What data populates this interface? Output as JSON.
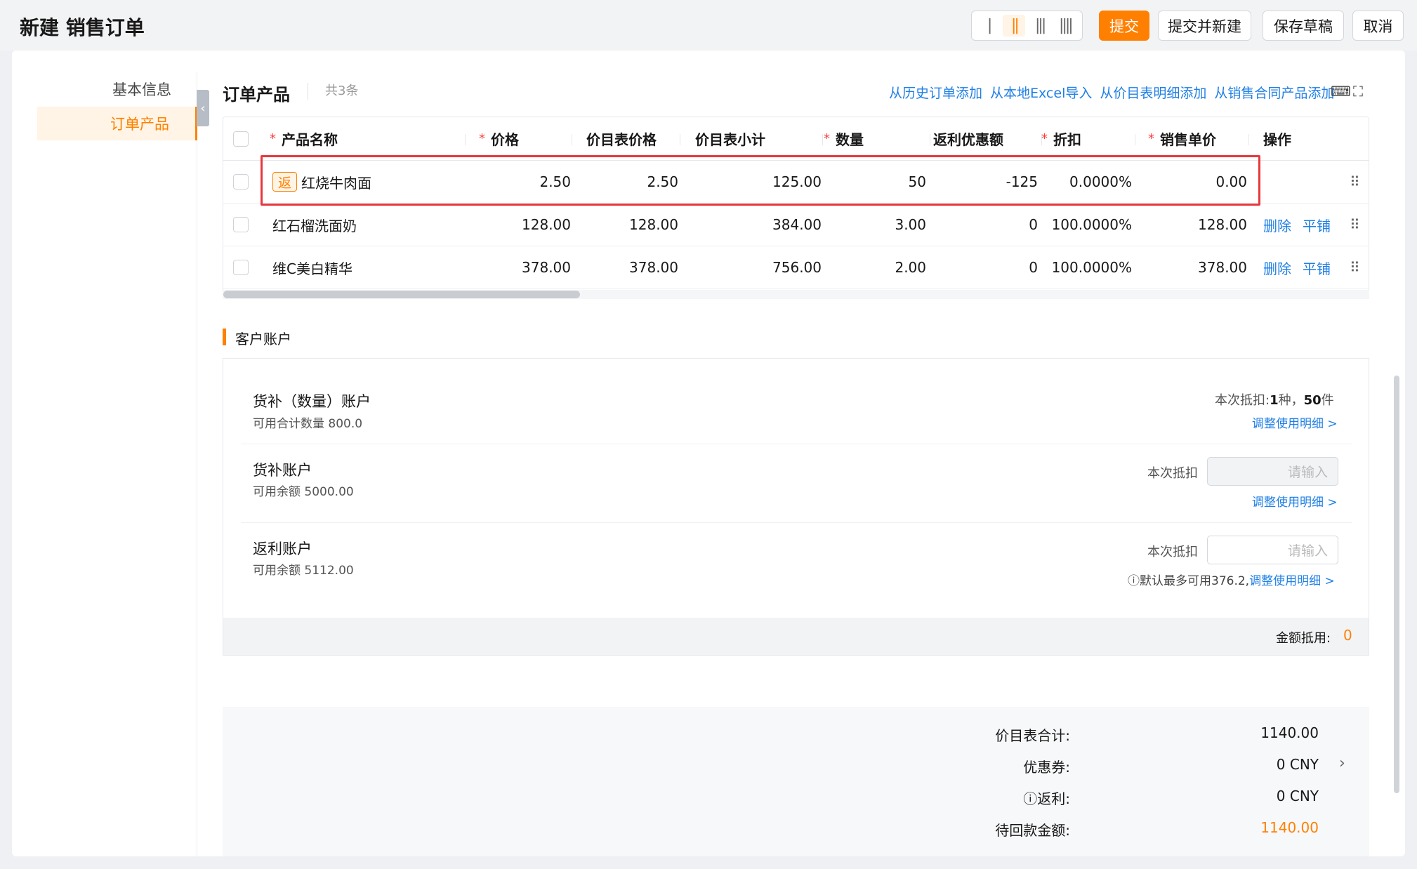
{
  "header": {
    "title": "新建 销售订单",
    "layout_options": [
      "|",
      "||",
      "|||",
      "||||"
    ],
    "buttons": {
      "submit": "提交",
      "submit_new": "提交并新建",
      "save_draft": "保存草稿",
      "cancel": "取消"
    }
  },
  "sidebar": {
    "items": [
      {
        "label": "基本信息"
      },
      {
        "label": "订单产品"
      }
    ]
  },
  "products": {
    "title": "订单产品",
    "count": "共3条",
    "links": [
      "从历史订单添加",
      "从本地Excel导入",
      "从价目表明细添加",
      "从销售合同产品添加"
    ],
    "columns": {
      "name": "产品名称",
      "price": "价格",
      "list_price": "价目表价格",
      "list_subtotal": "价目表小计",
      "qty": "数量",
      "rebate": "返利优惠额",
      "discount": "折扣",
      "unit_price": "销售单价",
      "actions": "操作"
    },
    "required_mark": "*",
    "badge": "返",
    "rows": [
      {
        "name": "红烧牛肉面",
        "price": "2.50",
        "list_price": "2.50",
        "list_subtotal": "125.00",
        "qty": "50",
        "rebate": "-125",
        "discount": "0.0000%",
        "unit_price": "0.00",
        "del": "",
        "tile": ""
      },
      {
        "name": "红石榴洗面奶",
        "price": "128.00",
        "list_price": "128.00",
        "list_subtotal": "384.00",
        "qty": "3.00",
        "rebate": "0",
        "discount": "100.0000%",
        "unit_price": "128.00",
        "del": "删除",
        "tile": "平铺"
      },
      {
        "name": "维C美白精华",
        "price": "378.00",
        "list_price": "378.00",
        "list_subtotal": "756.00",
        "qty": "2.00",
        "rebate": "0",
        "discount": "100.0000%",
        "unit_price": "378.00",
        "del": "删除",
        "tile": "平铺"
      }
    ],
    "icons": {
      "keyboard": "⌨",
      "fullscreen": "⛶",
      "drag": "⠿",
      "collapse": "‹"
    }
  },
  "account": {
    "title": "客户账户",
    "qty_account": {
      "name": "货补（数量）账户",
      "available": "可用合计数量 800.0",
      "deduct_prefix": "本次抵扣:",
      "deduct_kinds": "1",
      "deduct_kinds_unit": "种，",
      "deduct_pieces": "50",
      "deduct_pieces_unit": "件",
      "link": "调整使用明细 >"
    },
    "supply_account": {
      "name": "货补账户",
      "available": "可用余额 5000.00",
      "label": "本次抵扣",
      "placeholder": "请输入",
      "link": "调整使用明细 >"
    },
    "rebate_account": {
      "name": "返利账户",
      "available": "可用余额 5112.00",
      "label": "本次抵扣",
      "placeholder": "请输入",
      "hint": "默认最多可用376.2,",
      "link": "调整使用明细 >"
    },
    "footer_label": "金额抵用:",
    "footer_value": "0"
  },
  "totals": {
    "list_total_label": "价目表合计:",
    "list_total": "1140.00",
    "coupon_label": "优惠券:",
    "coupon": "0 CNY",
    "rebate_label": "返利:",
    "rebate": "0 CNY",
    "due_label": "待回款金额:",
    "due": "1140.00"
  }
}
